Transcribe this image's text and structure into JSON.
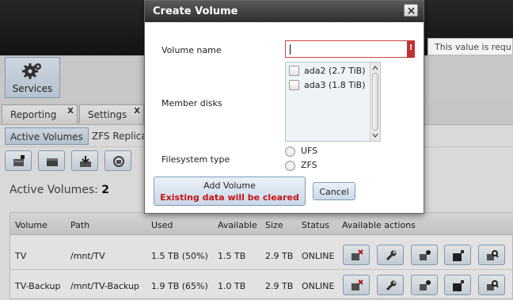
{
  "app": {
    "services_label": "Services",
    "tabs": [
      {
        "label": "Reporting",
        "close": "X"
      },
      {
        "label": "Settings",
        "close": "X"
      }
    ],
    "subtabs": [
      "Active Volumes",
      "ZFS Replica"
    ],
    "active_volumes_label": "Active Volumes:",
    "active_volumes_count": "2",
    "tooltip": "This value is requ",
    "table": {
      "headers": [
        "Volume",
        "Path",
        "Used",
        "Available",
        "Size",
        "Status",
        "Available actions"
      ],
      "rows": [
        {
          "volume": "TV",
          "path": "/mnt/TV",
          "used": "1.5 TB (50%)",
          "available": "1.5 TB",
          "size": "2.9 TB",
          "status": "ONLINE"
        },
        {
          "volume": "TV-Backup",
          "path": "/mnt/TV-Backup",
          "used": "1.9 TB (65%)",
          "available": "1.0 TB",
          "size": "2.9 TB",
          "status": "ONLINE"
        }
      ]
    }
  },
  "dialog": {
    "title": "Create Volume",
    "volume_name_label": "Volume name",
    "volume_name_value": "",
    "error_flag": "!",
    "member_disks_label": "Member disks",
    "disks": [
      "ada2 (2.7 TiB)",
      "ada3 (1.8 TiB)"
    ],
    "filesystem_label": "Filesystem type",
    "filesystems": [
      "UFS",
      "ZFS"
    ],
    "add_button_line1": "Add Volume",
    "add_button_line2": "Existing data will be cleared",
    "cancel_button": "Cancel"
  },
  "colors": {
    "accent_button": "#c9d8e8",
    "warning_text": "#c81414",
    "error_flag": "#c13232",
    "title_bar": "#2d2d2d"
  }
}
